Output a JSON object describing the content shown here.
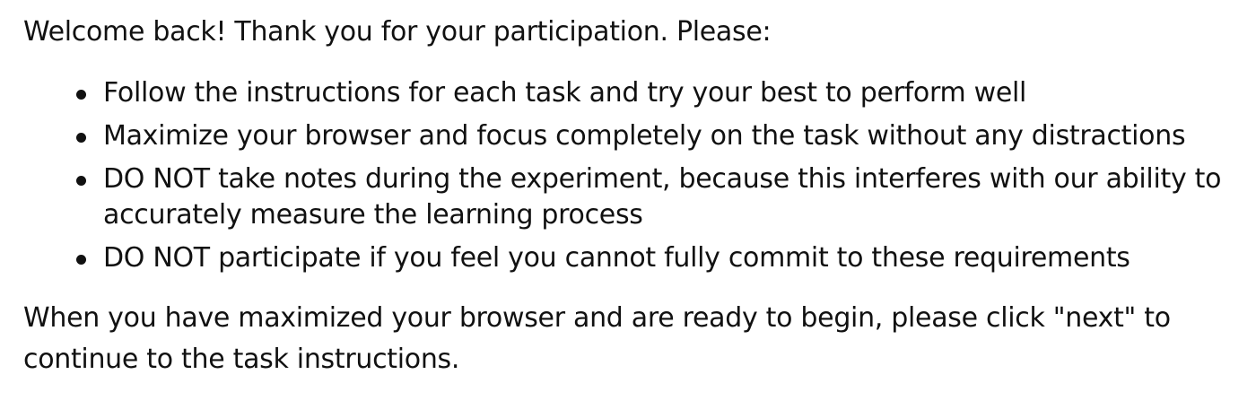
{
  "intro_text": "Welcome back! Thank you for your participation. Please:",
  "bullets": [
    "Follow the instructions for each task and try your best to perform well",
    "Maximize your browser and focus completely on the task without any distractions",
    "DO NOT take notes during the experiment, because this interferes with our ability to accurately measure the learning process",
    "DO NOT participate if you feel you cannot fully commit to these requirements"
  ],
  "outro_text": "When you have maximized your browser and are ready to begin, please click \"next\" to continue to the task instructions."
}
